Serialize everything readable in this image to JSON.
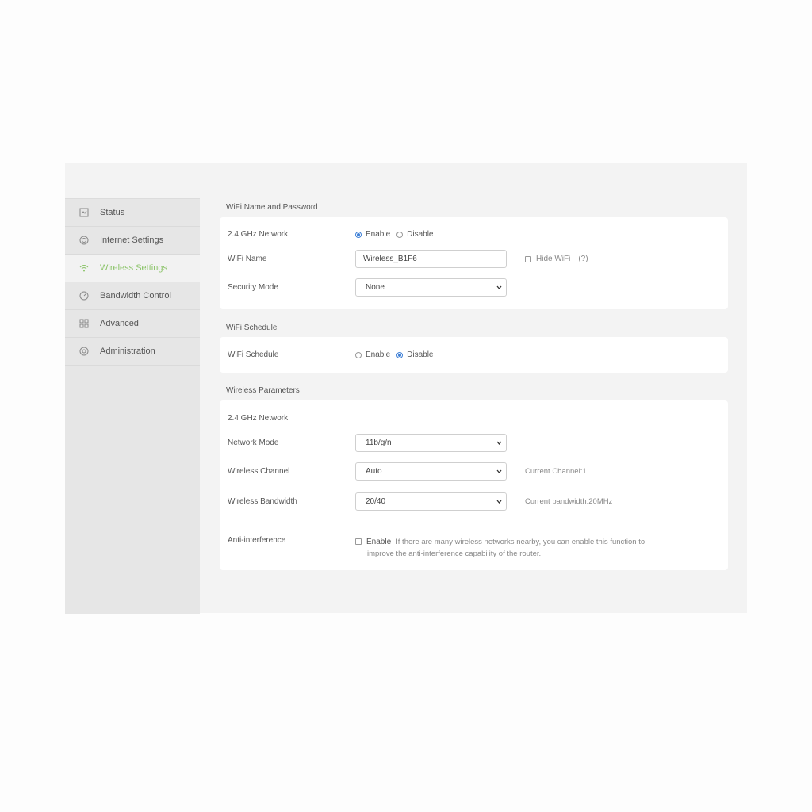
{
  "sidebar": {
    "items": [
      {
        "label": "Status",
        "icon": "status-icon",
        "active": false
      },
      {
        "label": "Internet Settings",
        "icon": "internet-icon",
        "active": false
      },
      {
        "label": "Wireless Settings",
        "icon": "wifi-icon",
        "active": true
      },
      {
        "label": "Bandwidth Control",
        "icon": "gauge-icon",
        "active": false
      },
      {
        "label": "Advanced",
        "icon": "grid-icon",
        "active": false
      },
      {
        "label": "Administration",
        "icon": "admin-icon",
        "active": false
      }
    ],
    "active_color": "#8cc46a"
  },
  "wifi_name_password": {
    "title": "WiFi Name and Password",
    "network_label": "2.4 GHz Network",
    "enable_label": "Enable",
    "disable_label": "Disable",
    "network_enabled": true,
    "wifi_name_label": "WiFi Name",
    "wifi_name_value": "Wireless_B1F6",
    "hide_wifi_label": "Hide WiFi",
    "help_label": "(?)",
    "security_mode_label": "Security Mode",
    "security_mode_value": "None"
  },
  "wifi_schedule": {
    "title": "WiFi Schedule",
    "label": "WiFi Schedule",
    "enable_label": "Enable",
    "disable_label": "Disable",
    "enabled": false
  },
  "wireless_parameters": {
    "title": "Wireless Parameters",
    "network_label": "2.4 GHz Network",
    "network_mode_label": "Network Mode",
    "network_mode_value": "11b/g/n",
    "channel_label": "Wireless Channel",
    "channel_value": "Auto",
    "channel_note": "Current Channel:1",
    "bandwidth_label": "Wireless Bandwidth",
    "bandwidth_value": "20/40",
    "bandwidth_note": "Current bandwidth:20MHz",
    "anti_label": "Anti-interference",
    "anti_enable_label": "Enable",
    "anti_hint_line1": "If there are many wireless networks nearby, you can enable this function to",
    "anti_hint_line2": "improve the anti-interference capability of the router."
  },
  "colors": {
    "accent_radio": "#3d7fd6",
    "active_menu": "#8cc46a"
  }
}
